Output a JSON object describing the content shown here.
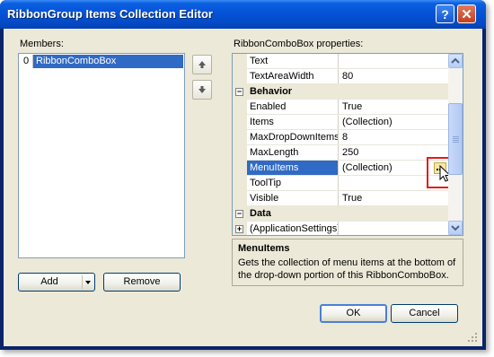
{
  "window": {
    "title": "RibbonGroup Items Collection Editor"
  },
  "members": {
    "label": "Members:",
    "items": [
      {
        "index": "0",
        "name": "RibbonComboBox"
      }
    ]
  },
  "buttons": {
    "add": "Add",
    "remove": "Remove",
    "ok": "OK",
    "cancel": "Cancel"
  },
  "properties": {
    "label": "RibbonComboBox properties:",
    "rows": [
      {
        "name": "Text",
        "value": ""
      },
      {
        "name": "TextAreaWidth",
        "value": "80"
      },
      {
        "category": "Behavior"
      },
      {
        "name": "Enabled",
        "value": "True"
      },
      {
        "name": "Items",
        "value": "(Collection)"
      },
      {
        "name": "MaxDropDownItems",
        "value": "8"
      },
      {
        "name": "MaxLength",
        "value": "250"
      },
      {
        "name": "MenuItems",
        "value": "(Collection)",
        "selected": true
      },
      {
        "name": "ToolTip",
        "value": ""
      },
      {
        "name": "Visible",
        "value": "True"
      },
      {
        "category": "Data"
      },
      {
        "name": "(ApplicationSettings)",
        "value": "",
        "expandable": true
      }
    ]
  },
  "description": {
    "title": "MenuItems",
    "text": "Gets the collection of menu items at the bottom of the drop-down portion of this RibbonComboBox."
  },
  "colors": {
    "titlebar": "#0553d6",
    "selection": "#316ac5",
    "highlight": "#e31b1b",
    "face": "#ece9d8"
  }
}
